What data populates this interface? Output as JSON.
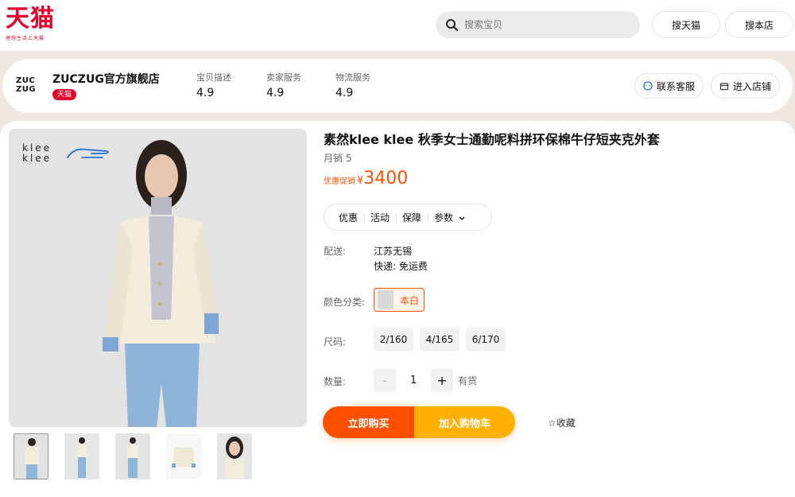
{
  "header": {
    "logo_text": "天猫",
    "logo_tagline": "理想生活上天猫",
    "search_placeholder": "搜索宝贝",
    "search_tmall_label": "搜天猫",
    "search_store_label": "搜本店"
  },
  "shop": {
    "logo_text_line1": "ZUC",
    "logo_text_line2": "ZUG",
    "name": "ZUCZUG官方旗舰店",
    "badge": "天猫",
    "ratings": [
      {
        "label": "宝贝描述",
        "value": "4.9"
      },
      {
        "label": "卖家服务",
        "value": "4.9"
      },
      {
        "label": "物流服务",
        "value": "4.9"
      }
    ],
    "contact_label": "联系客服",
    "enter_store_label": "进入店铺"
  },
  "product": {
    "brand_mark_line1": "klee",
    "brand_mark_line2": "klee",
    "title": "素然klee klee 秋季女士通勤呢料拼环保棉牛仔短夹克外套",
    "monthly_sales": "月销 5",
    "promo_label": "优惠促销",
    "currency": "¥",
    "price": "3400",
    "tabs": [
      "优惠",
      "活动",
      "保障",
      "参数"
    ],
    "shipping_label": "配送:",
    "ship_from": "江苏无锡",
    "ship_fee": "快递: 免运费",
    "color_label": "颜色分类:",
    "color_option": "本白",
    "size_label": "尺码:",
    "sizes": [
      "2/160",
      "4/165",
      "6/170"
    ],
    "qty_label": "数量:",
    "qty_minus": "-",
    "qty_value": "1",
    "qty_plus": "+",
    "stock": "有货",
    "buy_now": "立即购买",
    "add_to_cart": "加入购物车",
    "favorite": "☆收藏"
  },
  "colors": {
    "brand_red": "#e4002b",
    "accent_orange": "#ff5000",
    "cart_yellow": "#ffb000"
  }
}
